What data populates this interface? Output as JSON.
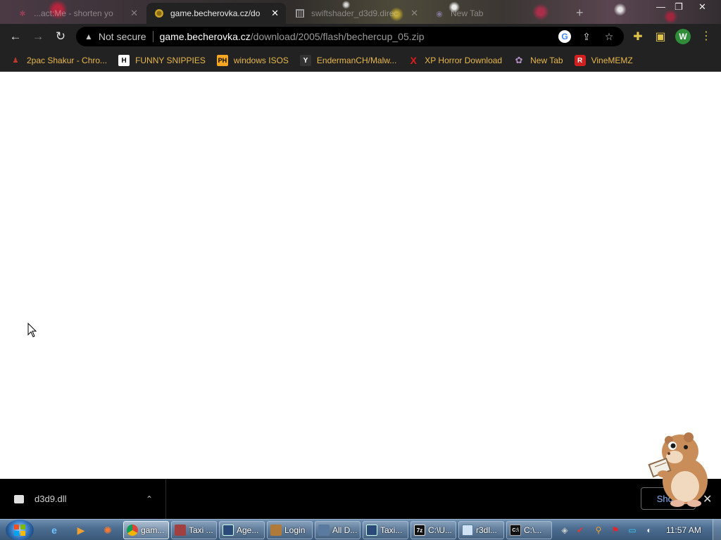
{
  "tabs": [
    {
      "title": "...act:Me - shorten yo",
      "favicon": "tab-favicon-1",
      "active": false
    },
    {
      "title": "game.becherovka.cz/do",
      "favicon": "coin-icon",
      "active": true
    },
    {
      "title": "swiftshader_d3d9.direc",
      "favicon": "archive-icon",
      "active": false
    },
    {
      "title": "New Tab",
      "favicon": "globe-icon",
      "active": false
    }
  ],
  "omnibox": {
    "security_label": "Not secure",
    "host": "game.becherovka.cz",
    "path": "/download/2005/flash/bechercup_05.zip"
  },
  "profile": {
    "initial": "W",
    "color": "#2f8d3a"
  },
  "bookmarks": [
    {
      "label": "2pac Shakur - Chro...",
      "icon_text": "",
      "icon_color": "#c0392b"
    },
    {
      "label": "FUNNY SNIPPIES",
      "icon_text": "H",
      "icon_color": "#ffffff"
    },
    {
      "label": "windows ISOS",
      "icon_text": "PH",
      "icon_color": "#f5a623"
    },
    {
      "label": "EndermanCH/Malw...",
      "icon_text": "Y",
      "icon_color": "#333333"
    },
    {
      "label": "XP Horror Download",
      "icon_text": "X",
      "icon_color": "#e01b1b"
    },
    {
      "label": "New Tab",
      "icon_text": "",
      "icon_color": "#8a5a9c"
    },
    {
      "label": "VineMEMZ",
      "icon_text": "R",
      "icon_color": "#d0201f"
    }
  ],
  "downloads": {
    "file_name": "d3d9.dll",
    "show_all_label": "Show"
  },
  "taskbar": {
    "buttons": [
      {
        "label": "gam...",
        "icon": "chrome-icon",
        "active": true
      },
      {
        "label": "Taxi ...",
        "icon": "app-icon",
        "active": false
      },
      {
        "label": "Age...",
        "icon": "window-icon",
        "active": false
      },
      {
        "label": "Login",
        "icon": "user-icon",
        "active": false
      },
      {
        "label": "All D...",
        "icon": "folder-icon",
        "active": false
      },
      {
        "label": "Taxi...",
        "icon": "window-icon",
        "active": false
      },
      {
        "label": "C:\\U...",
        "icon": "7zip-icon",
        "active": false
      },
      {
        "label": "r3dl...",
        "icon": "notepad-icon",
        "active": false
      },
      {
        "label": "C:\\...",
        "icon": "cmd-icon",
        "active": false
      }
    ],
    "clock": "11:57 AM"
  },
  "colors": {
    "chrome_bg": "#222222",
    "bookmark_text": "#e8b84a",
    "link_blue": "#8ab4f8"
  }
}
